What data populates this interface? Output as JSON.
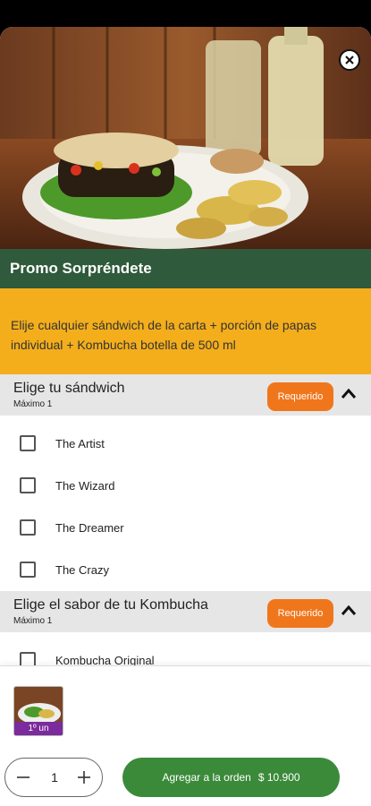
{
  "promo": {
    "title": "Promo Sorpréndete",
    "description": "Elije cualquier sándwich de la carta + porción de papas individual + Kombucha botella de 500 ml"
  },
  "sections": [
    {
      "title": "Elige tu sándwich",
      "subtitle": "Máximo 1",
      "badge": "Requerido",
      "options": [
        "The Artist",
        "The Wizard",
        "The Dreamer",
        "The Crazy"
      ]
    },
    {
      "title": "Elige el sabor de tu Kombucha",
      "subtitle": "Máximo 1",
      "badge": "Requerido",
      "options": [
        "Kombucha Original"
      ]
    }
  ],
  "footer": {
    "thumb_tag": "1º un",
    "quantity": "1",
    "add_label": "Agregar a la orden",
    "price": "$ 10.900"
  },
  "colors": {
    "title_bar": "#2f5a3b",
    "description_bg": "#f4ae1c",
    "badge": "#f0761c",
    "add_button": "#3b8a3a",
    "tag": "#7b2b9c"
  },
  "icons": [
    "close-icon",
    "chevron-up-icon",
    "minus-icon",
    "plus-icon",
    "checkbox-icon"
  ]
}
